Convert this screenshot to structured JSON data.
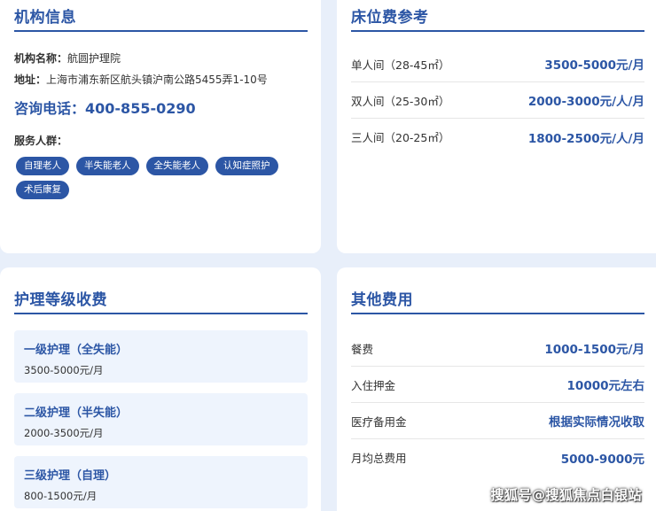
{
  "info": {
    "title": "机构信息",
    "name_label": "机构名称：",
    "name": "航圆护理院",
    "address_label": "地址：",
    "address": "上海市浦东新区航头镇沪南公路5455弄1-10号",
    "phone_label": "咨询电话：",
    "phone": "400-855-0290",
    "group_label": "服务人群：",
    "tags": [
      "自理老人",
      "半失能老人",
      "全失能老人",
      "认知症照护",
      "术后康复"
    ]
  },
  "bed": {
    "title": "床位费参考",
    "rows": [
      {
        "name": "单人间（28-45㎡）",
        "price": "3500-5000元/月"
      },
      {
        "name": "双人间（25-30㎡）",
        "price": "2000-3000元/人/月"
      },
      {
        "name": "三人间（20-25㎡）",
        "price": "1800-2500元/人/月"
      }
    ]
  },
  "care": {
    "title": "护理等级收费",
    "levels": [
      {
        "name": "一级护理（全失能）",
        "price": "3500-5000元/月"
      },
      {
        "name": "二级护理（半失能）",
        "price": "2000-3500元/月"
      },
      {
        "name": "三级护理（自理）",
        "price": "800-1500元/月"
      }
    ]
  },
  "other": {
    "title": "其他费用",
    "rows": [
      {
        "name": "餐费",
        "price": "1000-1500元/月"
      },
      {
        "name": "入住押金",
        "price": "10000元左右"
      },
      {
        "name": "医疗备用金",
        "price": "根据实际情况收取"
      },
      {
        "name": "月均总费用",
        "price": "5000-9000元"
      }
    ]
  },
  "watermark": "搜狐号@搜狐焦点白银站"
}
